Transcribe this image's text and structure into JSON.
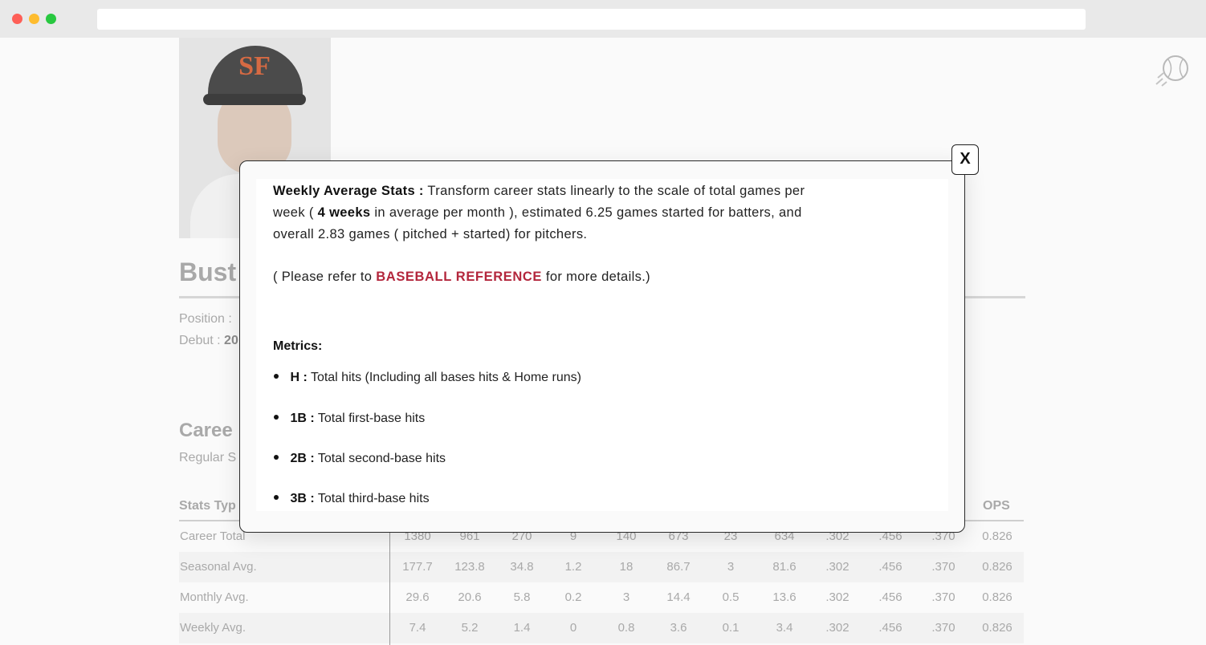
{
  "browser": {
    "url": ""
  },
  "player": {
    "name_partial": "Bust",
    "position_label": "Position :",
    "debut_label": "Debut :",
    "debut_value_partial": "20",
    "photo_logo": "SF"
  },
  "career": {
    "title_partial": "Caree",
    "subtitle_partial": "Regular S",
    "stats_type_header_partial": "Stats Typ",
    "ops_header": "OPS"
  },
  "stats_rows": [
    {
      "label": "Career Total",
      "values": [
        "1380",
        "961",
        "270",
        "9",
        "140",
        "673",
        "23",
        "634",
        ".302",
        ".456",
        ".370",
        "0.826"
      ]
    },
    {
      "label": "Seasonal Avg.",
      "values": [
        "177.7",
        "123.8",
        "34.8",
        "1.2",
        "18",
        "86.7",
        "3",
        "81.6",
        ".302",
        ".456",
        ".370",
        "0.826"
      ]
    },
    {
      "label": "Monthly Avg.",
      "values": [
        "29.6",
        "20.6",
        "5.8",
        "0.2",
        "3",
        "14.4",
        "0.5",
        "13.6",
        ".302",
        ".456",
        ".370",
        "0.826"
      ]
    },
    {
      "label": "Weekly Avg.",
      "values": [
        "7.4",
        "5.2",
        "1.4",
        "0",
        "0.8",
        "3.6",
        "0.1",
        "3.4",
        ".302",
        ".456",
        ".370",
        "0.826"
      ]
    }
  ],
  "modal": {
    "close_label": "X",
    "intro_title": "Weekly Average Stats :",
    "intro_text_1": "Transform career stats linearly to the scale of total games per",
    "intro_text_2a": "week (",
    "intro_bold": "4 weeks",
    "intro_text_2b": "in average per month ), estimated 6.25 games started for batters, and",
    "intro_text_3": "overall 2.83 games ( pitched + started) for pitchers.",
    "refer_prefix": "( Please refer to",
    "refer_link": "BASEBALL REFERENCE",
    "refer_suffix": "for more details.)",
    "metrics_title": "Metrics:",
    "metrics": [
      {
        "term": "H :",
        "desc": "Total hits (Including all bases hits & Home runs)"
      },
      {
        "term": "1B :",
        "desc": "Total first-base hits"
      },
      {
        "term": "2B :",
        "desc": "Total second-base hits"
      },
      {
        "term": "3B :",
        "desc": "Total third-base hits"
      }
    ]
  },
  "colors": {
    "accent_link": "#b3263c",
    "muted_text": "#a9a9a9"
  },
  "icons": {
    "corner": "baseball-icon"
  }
}
